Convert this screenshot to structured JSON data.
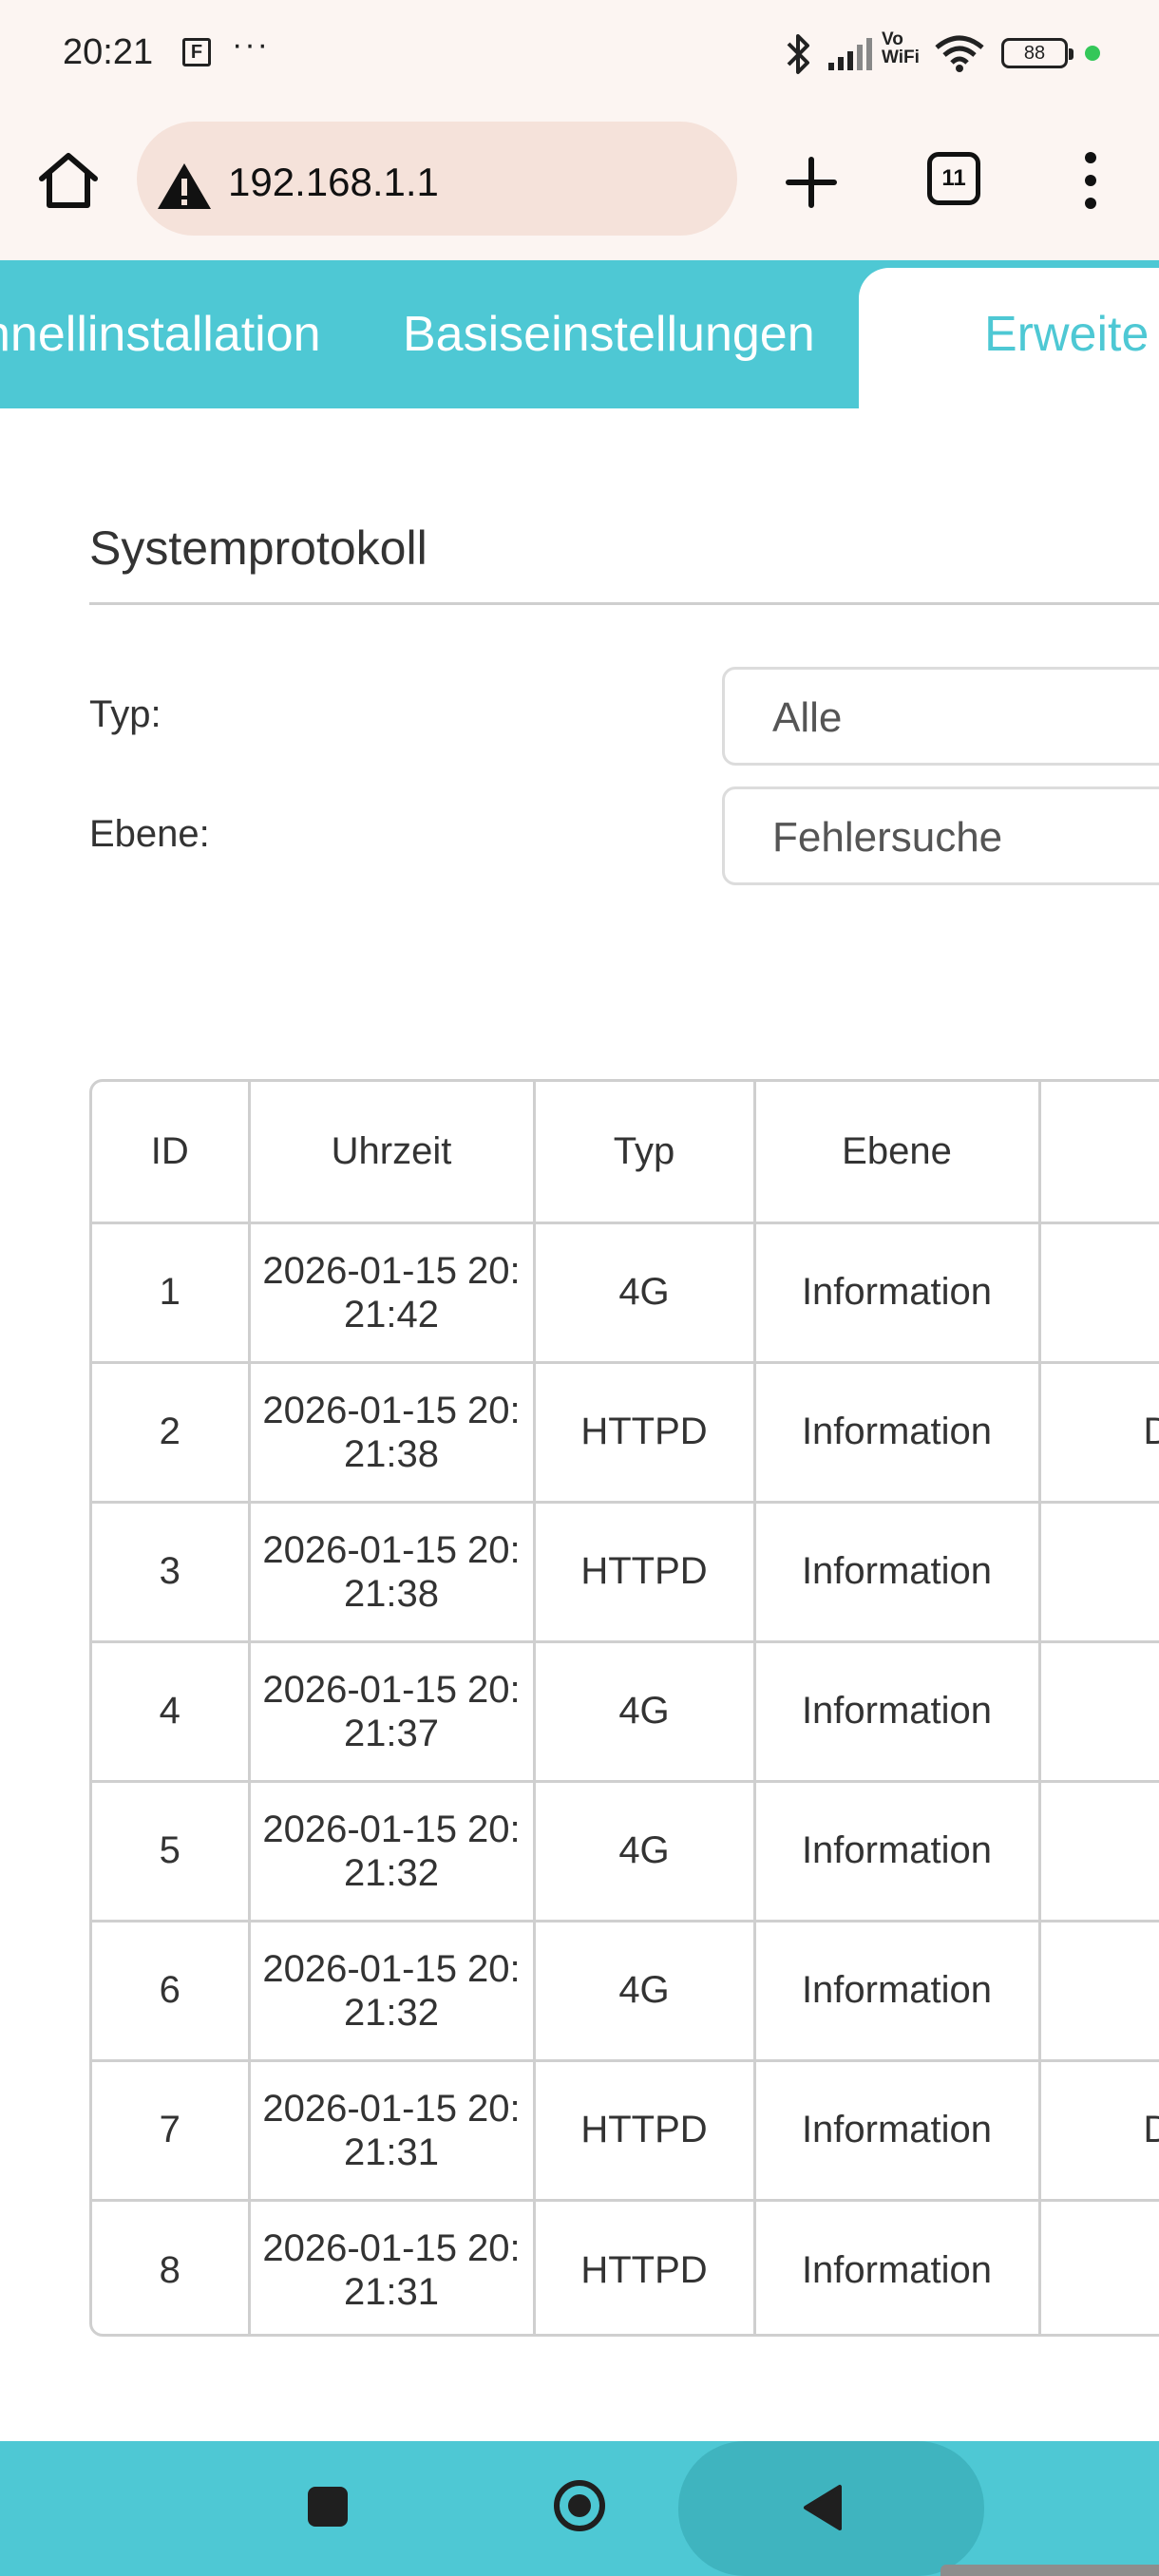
{
  "status_bar": {
    "time": "20:21",
    "f_badge": "F",
    "more": "···",
    "volte_label": "Vo WiFi",
    "battery": "88",
    "icons": [
      "bluetooth-icon",
      "signal-icon",
      "vowifi-icon",
      "wifi-icon",
      "battery-icon",
      "dot-indicator"
    ]
  },
  "browser": {
    "url": "192.168.1.1",
    "tab_count": "11",
    "icons": [
      "home-icon",
      "warning-icon",
      "plus-icon",
      "tabs-icon",
      "menu-icon"
    ]
  },
  "nav": {
    "tabs": [
      {
        "label": "hnellinstallation",
        "active": false
      },
      {
        "label": "Basiseinstellungen",
        "active": false
      },
      {
        "label": "Erweite",
        "active": true
      }
    ]
  },
  "page": {
    "title": "Systemprotokoll",
    "type_label": "Typ:",
    "type_value": "Alle",
    "level_label": "Ebene:",
    "level_value": "Fehlersuche"
  },
  "table": {
    "headers": [
      "ID",
      "Uhrzeit",
      "Typ",
      "Ebene",
      ""
    ],
    "rows": [
      {
        "id": "1",
        "time_a": "2026-01-15 20:",
        "time_b": "21:42",
        "type": "4G",
        "level": "Information",
        "more": ""
      },
      {
        "id": "2",
        "time_a": "2026-01-15 20:",
        "time_b": "21:38",
        "type": "HTTPD",
        "level": "Information",
        "more": "D"
      },
      {
        "id": "3",
        "time_a": "2026-01-15 20:",
        "time_b": "21:38",
        "type": "HTTPD",
        "level": "Information",
        "more": ""
      },
      {
        "id": "4",
        "time_a": "2026-01-15 20:",
        "time_b": "21:37",
        "type": "4G",
        "level": "Information",
        "more": ""
      },
      {
        "id": "5",
        "time_a": "2026-01-15 20:",
        "time_b": "21:32",
        "type": "4G",
        "level": "Information",
        "more": ""
      },
      {
        "id": "6",
        "time_a": "2026-01-15 20:",
        "time_b": "21:32",
        "type": "4G",
        "level": "Information",
        "more": ""
      },
      {
        "id": "7",
        "time_a": "2026-01-15 20:",
        "time_b": "21:31",
        "type": "HTTPD",
        "level": "Information",
        "more": "D"
      },
      {
        "id": "8",
        "time_a": "2026-01-15 20:",
        "time_b": "21:31",
        "type": "HTTPD",
        "level": "Information",
        "more": ""
      }
    ]
  },
  "system_nav": {
    "icons": [
      "recents-square-icon",
      "home-circle-icon",
      "back-triangle-icon"
    ]
  },
  "colors": {
    "accent": "#4ec8d4",
    "browser_bg": "#fcf5f2",
    "url_bg": "#f5e2da",
    "border": "#cfcfcf"
  }
}
